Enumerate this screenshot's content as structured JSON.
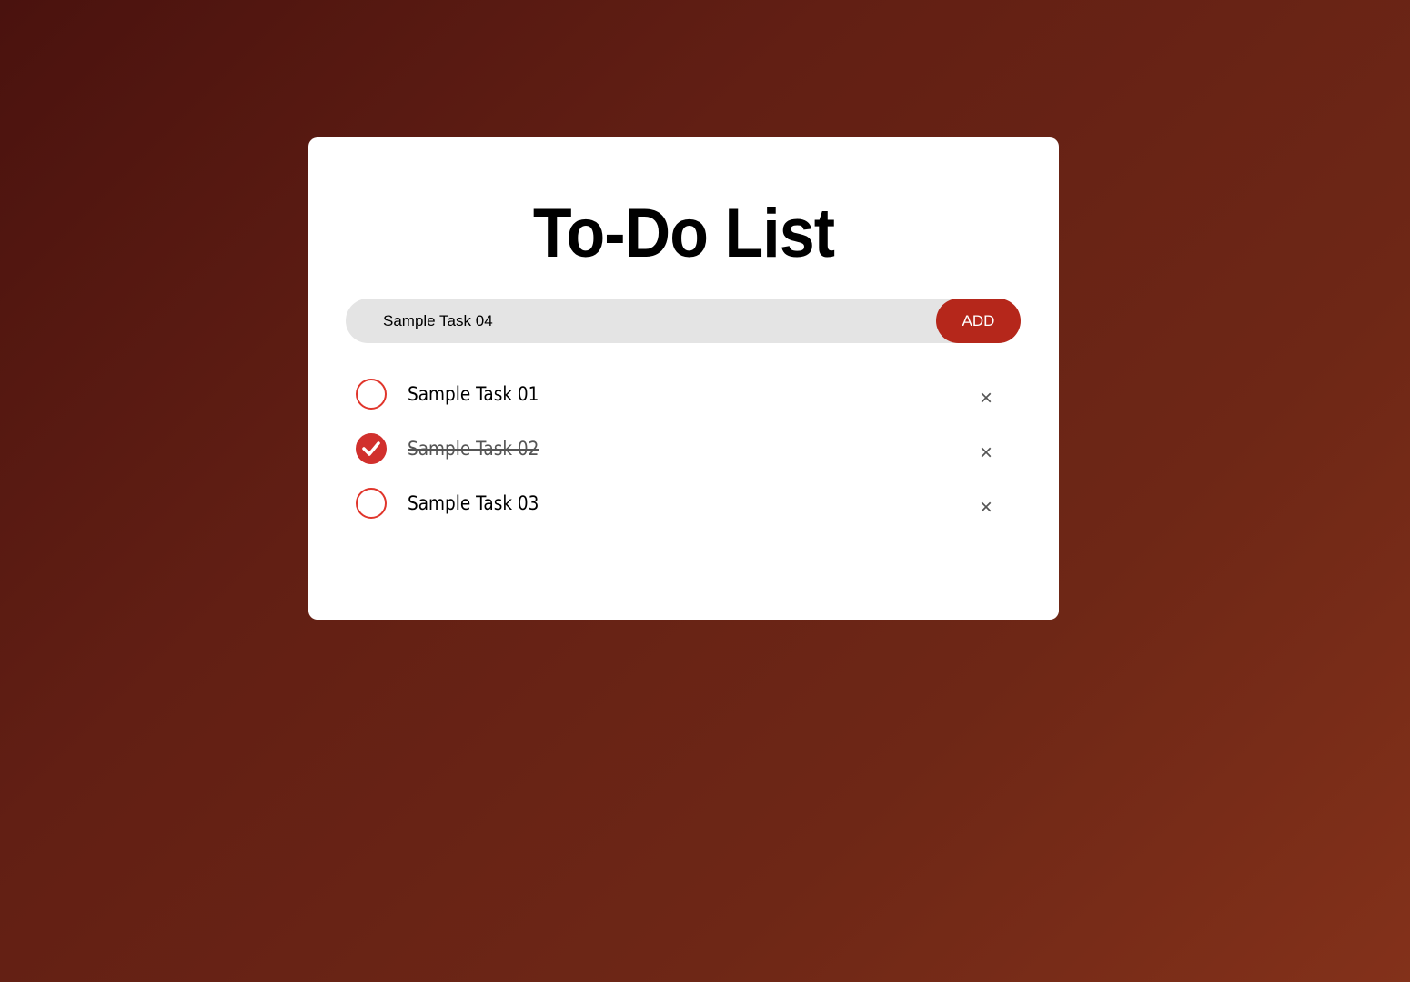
{
  "title": "To-Do List",
  "input": {
    "value": "Sample Task 04"
  },
  "add_label": "ADD",
  "delete_glyph": "×",
  "colors": {
    "accent": "#b5271b",
    "check": "#e0352b"
  },
  "tasks": [
    {
      "label": "Sample Task 01",
      "done": false
    },
    {
      "label": "Sample Task 02",
      "done": true
    },
    {
      "label": "Sample Task 03",
      "done": false
    }
  ]
}
